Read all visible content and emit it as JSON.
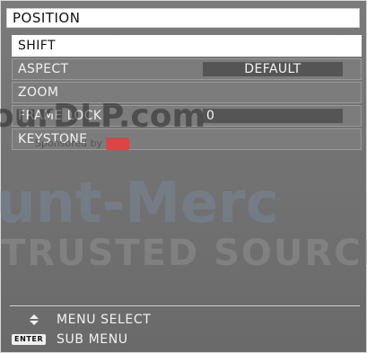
{
  "menu": {
    "title": "POSITION",
    "items": [
      {
        "label": "SHIFT",
        "value": ""
      },
      {
        "label": "ASPECT",
        "value": "DEFAULT"
      },
      {
        "label": "ZOOM",
        "value": ""
      },
      {
        "label": "FRAME LOCK",
        "value": "0"
      },
      {
        "label": "KEYSTONE",
        "value": ""
      }
    ]
  },
  "watermark": {
    "line1": "ourDLP.com",
    "line2": "Sponsored by",
    "line3": "ount-Merc",
    "line4": "TRUSTED SOURCE FO"
  },
  "footer": {
    "menu_select": "MENU SELECT",
    "sub_menu": "SUB MENU",
    "enter_label": "ENTER"
  }
}
